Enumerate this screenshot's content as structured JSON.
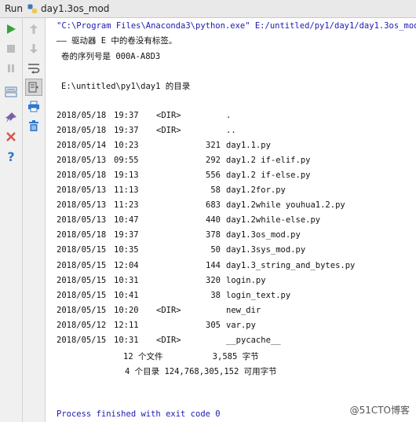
{
  "tabbar": {
    "run_label": "Run",
    "tab_title": "day1.3os_mod"
  },
  "console": {
    "command": "\"C:\\Program Files\\Anaconda3\\python.exe\" E:/untitled/py1/day1/day1.3os_mod.py",
    "volume_line": "—— 驱动器 E 中的卷没有标签。",
    "serial_line": "卷的序列号是 000A-A8D3",
    "dir_line": "E:\\untitled\\py1\\day1 的目录",
    "listing": [
      {
        "date": "2018/05/18",
        "time": "19:37",
        "kind": "<DIR>",
        "size": "",
        "name": "."
      },
      {
        "date": "2018/05/18",
        "time": "19:37",
        "kind": "<DIR>",
        "size": "",
        "name": ".."
      },
      {
        "date": "2018/05/14",
        "time": "10:23",
        "kind": "",
        "size": "321",
        "name": "day1.1.py"
      },
      {
        "date": "2018/05/13",
        "time": "09:55",
        "kind": "",
        "size": "292",
        "name": "day1.2 if-elif.py"
      },
      {
        "date": "2018/05/18",
        "time": "19:13",
        "kind": "",
        "size": "556",
        "name": "day1.2 if-else.py"
      },
      {
        "date": "2018/05/13",
        "time": "11:13",
        "kind": "",
        "size": "58",
        "name": "day1.2for.py"
      },
      {
        "date": "2018/05/13",
        "time": "11:23",
        "kind": "",
        "size": "683",
        "name": "day1.2while youhua1.2.py"
      },
      {
        "date": "2018/05/13",
        "time": "10:47",
        "kind": "",
        "size": "440",
        "name": "day1.2while-else.py"
      },
      {
        "date": "2018/05/18",
        "time": "19:37",
        "kind": "",
        "size": "378",
        "name": "day1.3os_mod.py"
      },
      {
        "date": "2018/05/15",
        "time": "10:35",
        "kind": "",
        "size": "50",
        "name": "day1.3sys_mod.py"
      },
      {
        "date": "2018/05/15",
        "time": "12:04",
        "kind": "",
        "size": "144",
        "name": "day1.3_string_and_bytes.py"
      },
      {
        "date": "2018/05/15",
        "time": "10:31",
        "kind": "",
        "size": "320",
        "name": "login.py"
      },
      {
        "date": "2018/05/15",
        "time": "10:41",
        "kind": "",
        "size": "38",
        "name": "login_text.py"
      },
      {
        "date": "2018/05/15",
        "time": "10:20",
        "kind": "<DIR>",
        "size": "",
        "name": "new_dir"
      },
      {
        "date": "2018/05/12",
        "time": "12:11",
        "kind": "",
        "size": "305",
        "name": "var.py"
      },
      {
        "date": "2018/05/15",
        "time": "10:31",
        "kind": "<DIR>",
        "size": "",
        "name": "__pycache__"
      }
    ],
    "summary_files": "12 个文件          3,585 字节",
    "summary_dirs": "4 个目录 124,768,305,152 可用字节",
    "exit_line": "Process finished with exit code 0"
  },
  "watermark": "@51CTO博客",
  "colors": {
    "run_green": "#3aa13a",
    "stop_red": "#d9534f",
    "help_blue": "#2f78d0",
    "output_blue": "#1a1ab0"
  }
}
